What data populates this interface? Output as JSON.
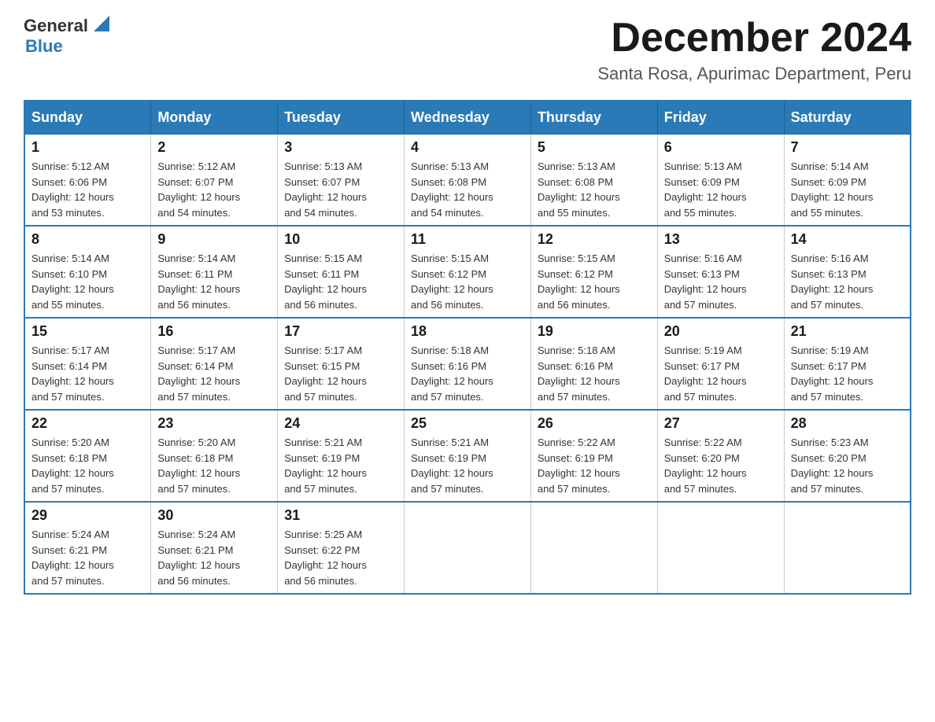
{
  "header": {
    "logo_general": "General",
    "logo_blue": "Blue",
    "month_title": "December 2024",
    "location": "Santa Rosa, Apurimac Department, Peru"
  },
  "days_of_week": [
    "Sunday",
    "Monday",
    "Tuesday",
    "Wednesday",
    "Thursday",
    "Friday",
    "Saturday"
  ],
  "weeks": [
    [
      {
        "day": "1",
        "sunrise": "5:12 AM",
        "sunset": "6:06 PM",
        "daylight": "12 hours and 53 minutes."
      },
      {
        "day": "2",
        "sunrise": "5:12 AM",
        "sunset": "6:07 PM",
        "daylight": "12 hours and 54 minutes."
      },
      {
        "day": "3",
        "sunrise": "5:13 AM",
        "sunset": "6:07 PM",
        "daylight": "12 hours and 54 minutes."
      },
      {
        "day": "4",
        "sunrise": "5:13 AM",
        "sunset": "6:08 PM",
        "daylight": "12 hours and 54 minutes."
      },
      {
        "day": "5",
        "sunrise": "5:13 AM",
        "sunset": "6:08 PM",
        "daylight": "12 hours and 55 minutes."
      },
      {
        "day": "6",
        "sunrise": "5:13 AM",
        "sunset": "6:09 PM",
        "daylight": "12 hours and 55 minutes."
      },
      {
        "day": "7",
        "sunrise": "5:14 AM",
        "sunset": "6:09 PM",
        "daylight": "12 hours and 55 minutes."
      }
    ],
    [
      {
        "day": "8",
        "sunrise": "5:14 AM",
        "sunset": "6:10 PM",
        "daylight": "12 hours and 55 minutes."
      },
      {
        "day": "9",
        "sunrise": "5:14 AM",
        "sunset": "6:11 PM",
        "daylight": "12 hours and 56 minutes."
      },
      {
        "day": "10",
        "sunrise": "5:15 AM",
        "sunset": "6:11 PM",
        "daylight": "12 hours and 56 minutes."
      },
      {
        "day": "11",
        "sunrise": "5:15 AM",
        "sunset": "6:12 PM",
        "daylight": "12 hours and 56 minutes."
      },
      {
        "day": "12",
        "sunrise": "5:15 AM",
        "sunset": "6:12 PM",
        "daylight": "12 hours and 56 minutes."
      },
      {
        "day": "13",
        "sunrise": "5:16 AM",
        "sunset": "6:13 PM",
        "daylight": "12 hours and 57 minutes."
      },
      {
        "day": "14",
        "sunrise": "5:16 AM",
        "sunset": "6:13 PM",
        "daylight": "12 hours and 57 minutes."
      }
    ],
    [
      {
        "day": "15",
        "sunrise": "5:17 AM",
        "sunset": "6:14 PM",
        "daylight": "12 hours and 57 minutes."
      },
      {
        "day": "16",
        "sunrise": "5:17 AM",
        "sunset": "6:14 PM",
        "daylight": "12 hours and 57 minutes."
      },
      {
        "day": "17",
        "sunrise": "5:17 AM",
        "sunset": "6:15 PM",
        "daylight": "12 hours and 57 minutes."
      },
      {
        "day": "18",
        "sunrise": "5:18 AM",
        "sunset": "6:16 PM",
        "daylight": "12 hours and 57 minutes."
      },
      {
        "day": "19",
        "sunrise": "5:18 AM",
        "sunset": "6:16 PM",
        "daylight": "12 hours and 57 minutes."
      },
      {
        "day": "20",
        "sunrise": "5:19 AM",
        "sunset": "6:17 PM",
        "daylight": "12 hours and 57 minutes."
      },
      {
        "day": "21",
        "sunrise": "5:19 AM",
        "sunset": "6:17 PM",
        "daylight": "12 hours and 57 minutes."
      }
    ],
    [
      {
        "day": "22",
        "sunrise": "5:20 AM",
        "sunset": "6:18 PM",
        "daylight": "12 hours and 57 minutes."
      },
      {
        "day": "23",
        "sunrise": "5:20 AM",
        "sunset": "6:18 PM",
        "daylight": "12 hours and 57 minutes."
      },
      {
        "day": "24",
        "sunrise": "5:21 AM",
        "sunset": "6:19 PM",
        "daylight": "12 hours and 57 minutes."
      },
      {
        "day": "25",
        "sunrise": "5:21 AM",
        "sunset": "6:19 PM",
        "daylight": "12 hours and 57 minutes."
      },
      {
        "day": "26",
        "sunrise": "5:22 AM",
        "sunset": "6:19 PM",
        "daylight": "12 hours and 57 minutes."
      },
      {
        "day": "27",
        "sunrise": "5:22 AM",
        "sunset": "6:20 PM",
        "daylight": "12 hours and 57 minutes."
      },
      {
        "day": "28",
        "sunrise": "5:23 AM",
        "sunset": "6:20 PM",
        "daylight": "12 hours and 57 minutes."
      }
    ],
    [
      {
        "day": "29",
        "sunrise": "5:24 AM",
        "sunset": "6:21 PM",
        "daylight": "12 hours and 57 minutes."
      },
      {
        "day": "30",
        "sunrise": "5:24 AM",
        "sunset": "6:21 PM",
        "daylight": "12 hours and 56 minutes."
      },
      {
        "day": "31",
        "sunrise": "5:25 AM",
        "sunset": "6:22 PM",
        "daylight": "12 hours and 56 minutes."
      },
      null,
      null,
      null,
      null
    ]
  ],
  "labels": {
    "sunrise": "Sunrise:",
    "sunset": "Sunset:",
    "daylight": "Daylight:"
  }
}
